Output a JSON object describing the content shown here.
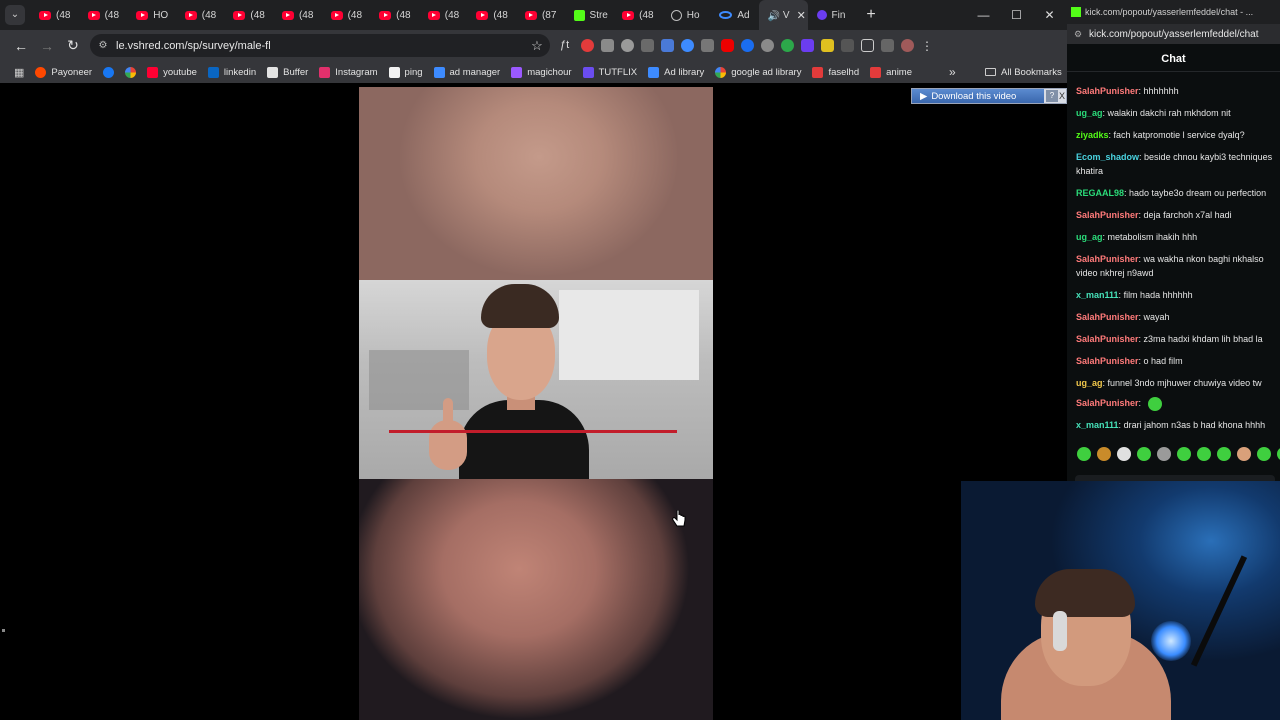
{
  "browser": {
    "tabs": [
      {
        "label": "(48",
        "icon": "youtube-icon"
      },
      {
        "label": "(48",
        "icon": "youtube-icon"
      },
      {
        "label": "HO",
        "icon": "youtube-icon"
      },
      {
        "label": "(48",
        "icon": "youtube-icon"
      },
      {
        "label": "(48",
        "icon": "youtube-icon"
      },
      {
        "label": "(48",
        "icon": "youtube-icon"
      },
      {
        "label": "(48",
        "icon": "youtube-icon"
      },
      {
        "label": "(48",
        "icon": "youtube-icon"
      },
      {
        "label": "(48",
        "icon": "youtube-icon"
      },
      {
        "label": "(48",
        "icon": "youtube-icon"
      },
      {
        "label": "(87",
        "icon": "youtube-icon"
      },
      {
        "label": "Stre",
        "icon": "kick-icon"
      },
      {
        "label": "(48",
        "icon": "youtube-icon"
      },
      {
        "label": "Ho",
        "icon": "globe-icon"
      },
      {
        "label": "Ad",
        "icon": "meta-icon"
      },
      {
        "label": "V",
        "icon": "speaker-icon"
      },
      {
        "label": "Fin",
        "icon": "purple-icon"
      }
    ],
    "active_tab_index": 15,
    "new_tab": "+",
    "window_controls": {
      "minimize": "—",
      "maximize": "☐",
      "close": "✕"
    },
    "address": {
      "url": "le.vshred.com/sp/survey/male-fl",
      "site_icon": "tune-icon"
    },
    "bookmarks": [
      {
        "label": "Payoneer",
        "icon": "payoneer-icon",
        "color": "#ff4800"
      },
      {
        "label": "",
        "icon": "facebook-icon",
        "color": "#1877f2"
      },
      {
        "label": "",
        "icon": "google-icon",
        "color": "#ffffff"
      },
      {
        "label": "youtube",
        "icon": "youtube-icon",
        "color": "#ff0033"
      },
      {
        "label": "linkedin",
        "icon": "linkedin-icon",
        "color": "#0a66c2"
      },
      {
        "label": "Buffer",
        "icon": "buffer-icon",
        "color": "#e3e3e3"
      },
      {
        "label": "Instagram",
        "icon": "instagram-icon",
        "color": "#e1306c"
      },
      {
        "label": "ping",
        "icon": "ping-icon",
        "color": "#f2f2f2"
      },
      {
        "label": "ad manager",
        "icon": "meta-icon",
        "color": "#3d8bff"
      },
      {
        "label": "magichour",
        "icon": "magichour-icon",
        "color": "#9b59ff"
      },
      {
        "label": "TUTFLIX",
        "icon": "tutflix-icon",
        "color": "#6b4df0"
      },
      {
        "label": "Ad library",
        "icon": "meta-icon",
        "color": "#3d8bff"
      },
      {
        "label": "google ad library",
        "icon": "google-icon",
        "color": "#ffffff"
      },
      {
        "label": "faselhd",
        "icon": "faselhd-icon",
        "color": "#e23b3b"
      },
      {
        "label": "anime",
        "icon": "anime-icon",
        "color": "#e23b3b"
      }
    ],
    "bookmarks_more": "»",
    "all_bookmarks": "All Bookmarks",
    "download_bar": {
      "label": "Download this video",
      "help": "?",
      "close": "X"
    }
  },
  "chat": {
    "window_title": "kick.com/popout/yasserlemfeddel/chat - ...",
    "url": "kick.com/popout/yasserlemfeddel/chat",
    "header": "Chat",
    "messages": [
      {
        "user": "SalahPunisher",
        "text": "hhhhhhh",
        "color": "#ff7a7a"
      },
      {
        "user": "ug_ag",
        "text": "walakin dakchi rah mkhdom nit",
        "color": "#2bdc7a"
      },
      {
        "user": "ziyadks",
        "text": "fach katpromotie l service dyalq?",
        "color": "#53fc18"
      },
      {
        "user": "Ecom_shadow",
        "text": "beside chnou kaybi3 techniques khatira",
        "color": "#4ad3e0"
      },
      {
        "user": "REGAAL98",
        "text": "hado taybe3o dream ou perfection",
        "color": "#2bdc7a"
      },
      {
        "user": "SalahPunisher",
        "text": "deja farchoh x7al hadi",
        "color": "#ff7a7a"
      },
      {
        "user": "ug_ag",
        "text": "metabolism ihakih hhh",
        "color": "#2bdc7a"
      },
      {
        "user": "SalahPunisher",
        "text": "wa wakha nkon baghi nkhalso video nkhrej n9awd",
        "color": "#ff7a7a"
      },
      {
        "user": "x_man111",
        "text": "film hada hhhhhh",
        "color": "#46e0b8"
      },
      {
        "user": "SalahPunisher",
        "text": "wayah",
        "color": "#ff7a7a"
      },
      {
        "user": "SalahPunisher",
        "text": "z3ma hadxi khdam lih bhad la",
        "color": "#ff7a7a"
      },
      {
        "user": "SalahPunisher",
        "text": "o had film",
        "color": "#ff7a7a"
      },
      {
        "user": "ug_ag",
        "text": "funnel 3ndo mjhuwer chuwiya video tw",
        "color": "#f2c84b"
      },
      {
        "user": "SalahPunisher",
        "text": "",
        "color": "#ff7a7a",
        "emote": "pepe-emote"
      },
      {
        "user": "x_man111",
        "text": "drari jahom n3as b had khona hhhh",
        "color": "#46e0b8"
      }
    ],
    "emote_bar": [
      "#3fcf3f",
      "#c98b2a",
      "#e0e0e0",
      "#3fcf3f",
      "#9a9a9a",
      "#3fcf3f",
      "#3fcf3f",
      "#3fcf3f",
      "#d9a07a",
      "#3fcf3f",
      "#3fcf3f"
    ]
  }
}
